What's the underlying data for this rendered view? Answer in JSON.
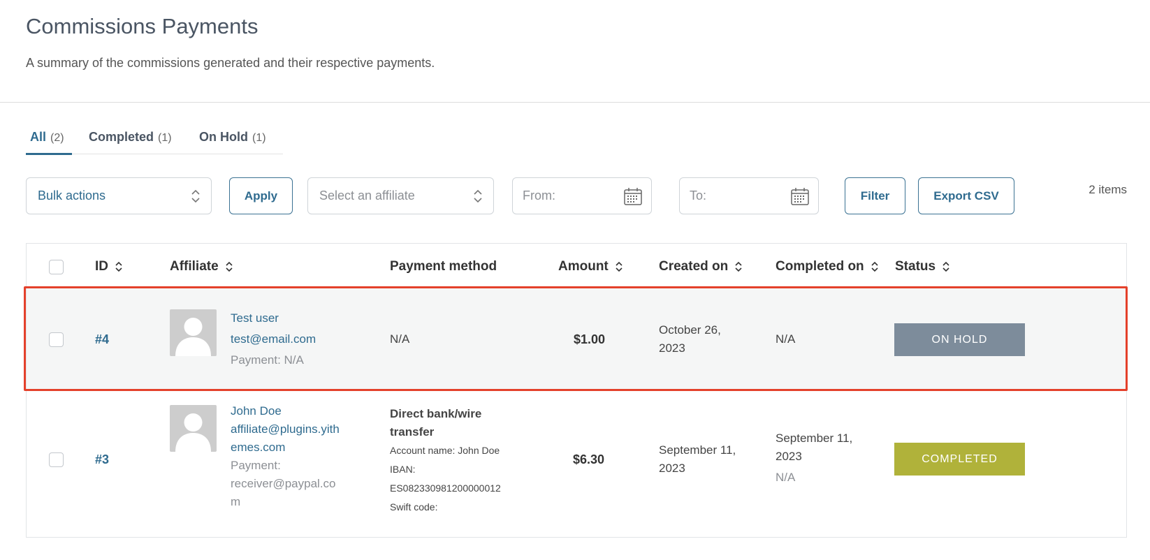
{
  "header": {
    "title": "Commissions Payments",
    "description": "A summary of the commissions generated and their respective payments."
  },
  "tabs": [
    {
      "label": "All",
      "count": "(2)",
      "active": true
    },
    {
      "label": "Completed",
      "count": "(1)",
      "active": false
    },
    {
      "label": "On Hold",
      "count": "(1)",
      "active": false
    }
  ],
  "toolbar": {
    "bulk_actions": "Bulk actions",
    "apply": "Apply",
    "affiliate_placeholder": "Select an affiliate",
    "from_placeholder": "From:",
    "to_placeholder": "To:",
    "filter": "Filter",
    "export": "Export CSV",
    "items_count": "2 items"
  },
  "table": {
    "columns": {
      "id": "ID",
      "affiliate": "Affiliate",
      "payment_method": "Payment method",
      "amount": "Amount",
      "created_on": "Created on",
      "completed_on": "Completed on",
      "status": "Status"
    },
    "rows": [
      {
        "id": "#4",
        "affiliate_name": "Test user",
        "affiliate_email": "test@email.com",
        "affiliate_payment": "Payment: N/A",
        "payment_method": "N/A",
        "amount": "$1.00",
        "created_line1": "October 26,",
        "created_line2": "2023",
        "completed": "N/A",
        "status": "ON HOLD",
        "status_color": "#7d8c9b"
      },
      {
        "id": "#3",
        "affiliate_name": "John Doe",
        "affiliate_email_line1": "affiliate@plugins.yith",
        "affiliate_email_line2": "emes.com",
        "affiliate_payment_line1": "Payment:",
        "affiliate_payment_line2": "receiver@paypal.co",
        "affiliate_payment_line3": "m",
        "pm_title_line1": "Direct bank/wire",
        "pm_title_line2": "transfer",
        "pm_account": "Account name: John Doe",
        "pm_iban_label": "IBAN:",
        "pm_iban": "ES082330981200000012",
        "pm_swift": "Swift code:",
        "amount": "$6.30",
        "created_line1": "September 11,",
        "created_line2": "2023",
        "completed_line1": "September 11,",
        "completed_line2": "2023",
        "completed_line3": "N/A",
        "status": "COMPLETED",
        "status_color": "#b0b23a"
      }
    ]
  },
  "colors": {
    "accent": "#2f6b8f",
    "highlight_border": "#e4412b",
    "on_hold": "#7d8c9b",
    "completed": "#b0b23a"
  }
}
